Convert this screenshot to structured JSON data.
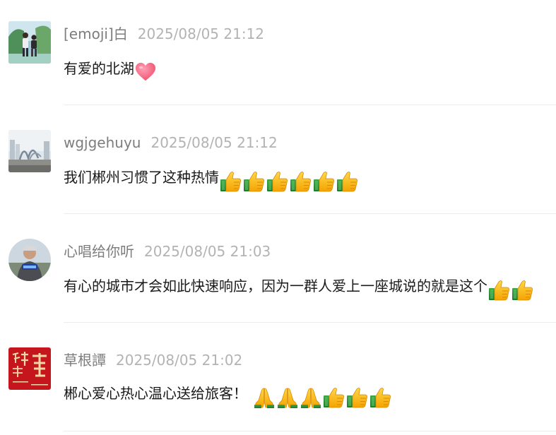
{
  "comments": [
    {
      "username": "[emoji]白",
      "time": "2025/08/05 21:12",
      "text": "有爱的北湖",
      "emojis": [
        "heart-emoji"
      ],
      "avatar": "avatar-couple-photo"
    },
    {
      "username": "wgjgehuyu",
      "time": "2025/08/05 21:12",
      "text": "我们郴州习惯了这种热情",
      "emojis": [
        "thumbs-up-emoji",
        "thumbs-up-emoji",
        "thumbs-up-emoji",
        "thumbs-up-emoji",
        "thumbs-up-emoji",
        "thumbs-up-emoji"
      ],
      "avatar": "avatar-city-photo"
    },
    {
      "username": "心唱给你听",
      "time": "2025/08/05 21:03",
      "text": "有心的城市才会如此快速响应，因为一群人爱上一座城说的就是这个",
      "emojis": [
        "thumbs-up-emoji",
        "thumbs-up-emoji"
      ],
      "avatar": "avatar-man-photo"
    },
    {
      "username": "草根譚",
      "time": "2025/08/05 21:02",
      "text": "郴心爱心热心温心送给旅客！",
      "emojis": [
        "folded-hands-emoji",
        "folded-hands-emoji",
        "folded-hands-emoji",
        "thumbs-up-emoji",
        "thumbs-up-emoji",
        "thumbs-up-emoji"
      ],
      "avatar": "avatar-red-calligraphy"
    }
  ],
  "colors": {
    "username": "#7d7d7d",
    "timestamp": "#b3b3b3",
    "text": "#1a1a1a",
    "divider": "#ececec",
    "avatar_red": "#c4161c"
  }
}
